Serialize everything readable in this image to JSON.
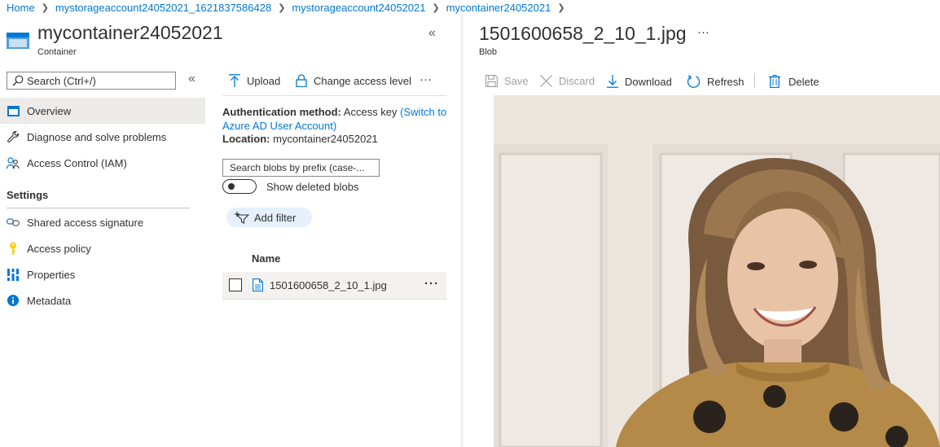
{
  "breadcrumb": {
    "items": [
      "Home",
      "mystorageaccount24052021_1621837586428",
      "mystorageaccount24052021",
      "mycontainer24052021"
    ]
  },
  "container": {
    "title": "mycontainer24052021",
    "subtitle": "Container"
  },
  "sidebar": {
    "search_placeholder": "Search (Ctrl+/)",
    "items": [
      {
        "label": "Overview",
        "icon": "overview-icon",
        "selected": true
      },
      {
        "label": "Diagnose and solve problems",
        "icon": "wrench-icon"
      },
      {
        "label": "Access Control (IAM)",
        "icon": "people-icon"
      }
    ],
    "settings_heading": "Settings",
    "settings_items": [
      {
        "label": "Shared access signature",
        "icon": "link-icon"
      },
      {
        "label": "Access policy",
        "icon": "key-icon"
      },
      {
        "label": "Properties",
        "icon": "properties-icon"
      },
      {
        "label": "Metadata",
        "icon": "info-icon"
      }
    ]
  },
  "toolbar": {
    "upload": "Upload",
    "change_access": "Change access level",
    "more": "···"
  },
  "auth": {
    "label": "Authentication method:",
    "value": "Access key",
    "switch_link": "(Switch to Azure AD User Account)",
    "switch_link_line1": "(Switch to",
    "switch_link_line2": "Azure AD User Account)",
    "location_label": "Location:",
    "location_value": "mycontainer24052021"
  },
  "blob_search": {
    "placeholder": "Search blobs by prefix (case-..."
  },
  "show_deleted": {
    "label": "Show deleted blobs",
    "on": false
  },
  "filter": {
    "label": "Add filter"
  },
  "table": {
    "header_name": "Name",
    "rows": [
      {
        "name": "1501600658_2_10_1.jpg",
        "more": "···"
      }
    ]
  },
  "blob": {
    "title": "1501600658_2_10_1.jpg",
    "subtitle": "Blob",
    "more": "···",
    "toolbar": {
      "save": "Save",
      "discard": "Discard",
      "download": "Download",
      "refresh": "Refresh",
      "delete": "Delete"
    }
  },
  "colors": {
    "accent": "#0078d4",
    "selected_bg": "#edebe9",
    "filter_pill_bg": "#e5f0fb",
    "key_icon": "#fcd116"
  }
}
